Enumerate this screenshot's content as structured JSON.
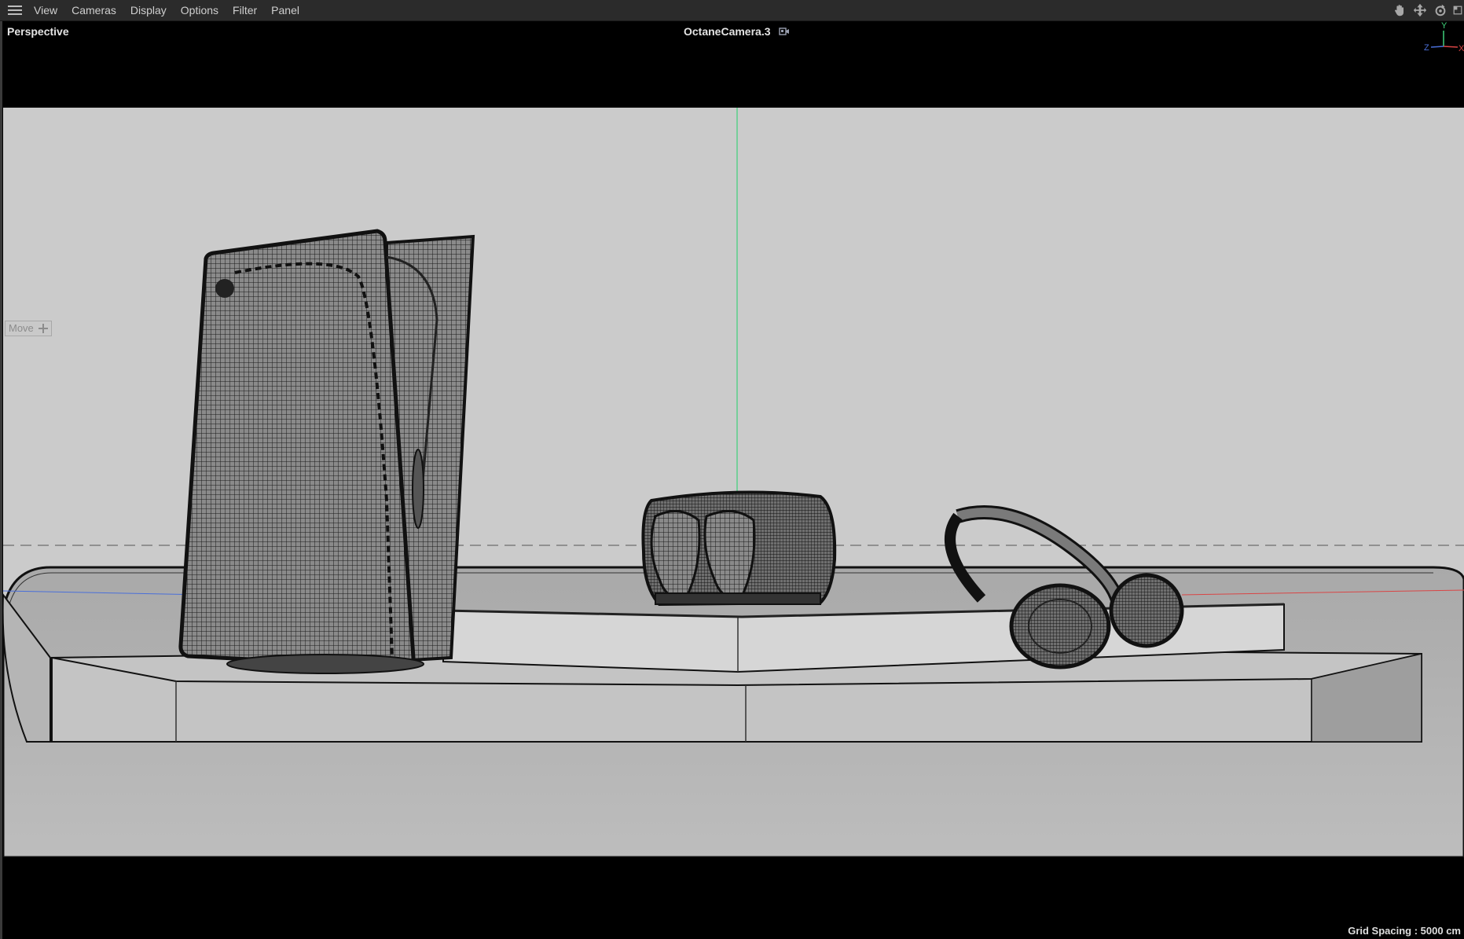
{
  "menubar": {
    "items": [
      {
        "label": "View"
      },
      {
        "label": "Cameras"
      },
      {
        "label": "Display"
      },
      {
        "label": "Options"
      },
      {
        "label": "Filter"
      },
      {
        "label": "Panel"
      }
    ],
    "nav_tools": [
      "pan-hand-icon",
      "move-arrows-icon",
      "rotate-icon",
      "maximize-icon"
    ]
  },
  "viewport": {
    "view_name": "Perspective",
    "camera_name": "OctaneCamera.3",
    "move_hud_label": "Move",
    "grid_spacing": "Grid Spacing : 5000 cm",
    "axis_labels": {
      "y": "Y",
      "z": "Z",
      "x": "X"
    },
    "colors": {
      "background": "#c9c9c9",
      "y_axis": "#3fd17a",
      "x_axis": "#d94545",
      "z_axis": "#4a6fd9",
      "wireframe": "#111111"
    }
  }
}
